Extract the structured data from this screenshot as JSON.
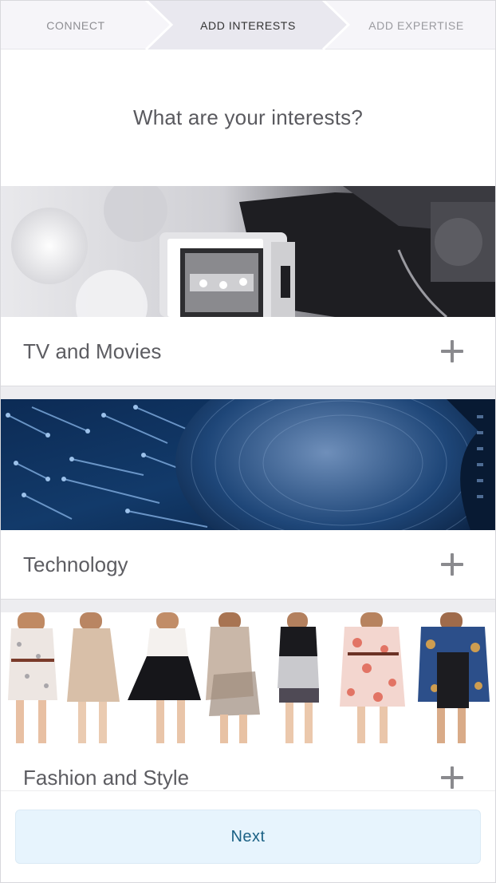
{
  "stepper": {
    "steps": [
      {
        "label": "CONNECT",
        "state": "completed"
      },
      {
        "label": "ADD INTERESTS",
        "state": "active"
      },
      {
        "label": "ADD EXPERTISE",
        "state": "upcoming"
      }
    ]
  },
  "main": {
    "title": "What are your interests?",
    "interests": [
      {
        "label": "TV and Movies",
        "image": "video-camera-photo",
        "action_icon": "plus-icon"
      },
      {
        "label": "Technology",
        "image": "circuit-board-vinyl-photo",
        "action_icon": "plus-icon"
      },
      {
        "label": "Fashion and Style",
        "image": "dresses-models-photo",
        "action_icon": "plus-icon"
      }
    ]
  },
  "footer": {
    "next_label": "Next"
  },
  "colors": {
    "accent_text": "#1b6185",
    "button_bg": "#e7f4fd",
    "stepper_bg": "#f6f5f9",
    "active_step_bg": "#e9e8ef"
  }
}
